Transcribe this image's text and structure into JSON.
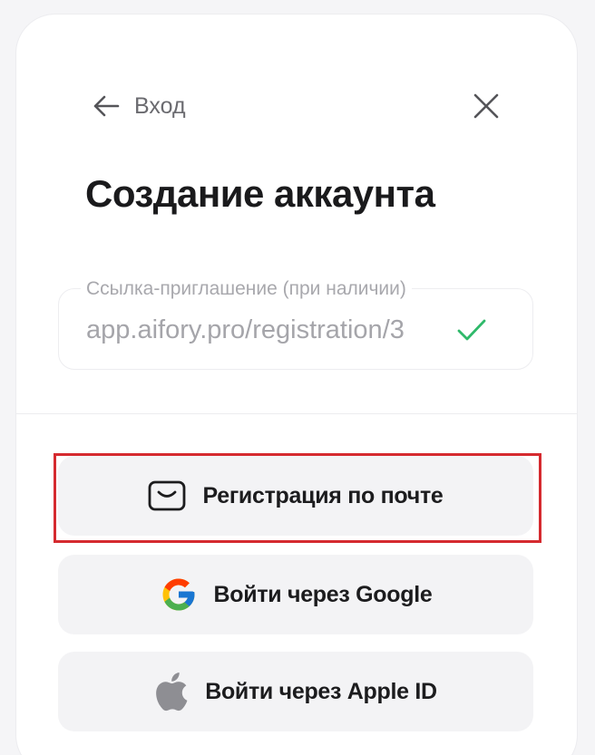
{
  "header": {
    "back_label": "Вход"
  },
  "title": "Создание аккаунта",
  "invite_field": {
    "label": "Ссылка-приглашение (при наличии)",
    "value": "app.aifory.pro/registration/3"
  },
  "buttons": {
    "email": "Регистрация по почте",
    "google": "Войти через Google",
    "apple": "Войти через Apple ID"
  },
  "colors": {
    "highlight": "#d52a2f",
    "check": "#2fb96a",
    "button_bg": "#f3f3f5"
  },
  "icons": {
    "back": "arrow-left-icon",
    "close": "close-icon",
    "check": "check-icon",
    "email": "mail-icon",
    "google": "google-icon",
    "apple": "apple-icon"
  }
}
